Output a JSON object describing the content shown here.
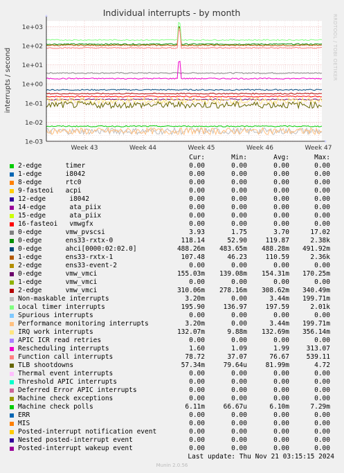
{
  "title": "Individual interrupts - by month",
  "watermark": "RRDTOOL / TOBI OETIKER",
  "footer": {
    "last_update": "Last update: Thu Nov 21 03:15:15 2024",
    "munin": "Munin 2.0.56"
  },
  "legend_headers": {
    "cur": "Cur:",
    "min": "Min:",
    "avg": "Avg:",
    "max": "Max:"
  },
  "chart_data": {
    "type": "line",
    "title": "Individual interrupts - by month",
    "ylabel": "interrupts / second",
    "yscale": "log",
    "ylim": [
      0.001,
      2000
    ],
    "yticks": [
      "1e-03",
      "1e-02",
      "1e-01",
      "1e+00",
      "1e+01",
      "1e+02",
      "1e+03"
    ],
    "xticks": [
      "Week 43",
      "Week 44",
      "Week 45",
      "Week 46",
      "Week 47"
    ],
    "grid": true,
    "series": [
      {
        "name": "2-edge      timer",
        "color": "#00cc00",
        "cur": "0.00",
        "min": "0.00",
        "avg": "0.00",
        "max": "0.00",
        "level": 0
      },
      {
        "name": "1-edge      i8042",
        "color": "#0066b3",
        "cur": "0.00",
        "min": "0.00",
        "avg": "0.00",
        "max": "0.00",
        "level": 0
      },
      {
        "name": "8-edge      rtc0",
        "color": "#ff8000",
        "cur": "0.00",
        "min": "0.00",
        "avg": "0.00",
        "max": "0.00",
        "level": 0
      },
      {
        "name": "9-fasteoi   acpi",
        "color": "#ffcc00",
        "cur": "0.00",
        "min": "0.00",
        "avg": "0.00",
        "max": "0.00",
        "level": 0
      },
      {
        "name": "12-edge      i8042",
        "color": "#330099",
        "cur": "0.00",
        "min": "0.00",
        "avg": "0.00",
        "max": "0.00",
        "level": 0
      },
      {
        "name": "14-edge      ata_piix",
        "color": "#990099",
        "cur": "0.00",
        "min": "0.00",
        "avg": "0.00",
        "max": "0.00",
        "level": 0
      },
      {
        "name": "15-edge      ata_piix",
        "color": "#ccff00",
        "cur": "0.00",
        "min": "0.00",
        "avg": "0.00",
        "max": "0.00",
        "level": 0
      },
      {
        "name": "16-fasteoi   vmwgfx",
        "color": "#ff0000",
        "cur": "0.00",
        "min": "0.00",
        "avg": "0.00",
        "max": "0.00",
        "level": 0.22
      },
      {
        "name": "0-edge      vmw_pvscsi",
        "color": "#808080",
        "cur": "3.93",
        "min": "1.75",
        "avg": "3.70",
        "max": "17.02",
        "level": 3.7
      },
      {
        "name": "0-edge      ens33-rxtx-0",
        "color": "#008f00",
        "cur": "118.14",
        "min": "52.90",
        "avg": "119.87",
        "max": "2.38k",
        "level": 120
      },
      {
        "name": "0-edge      ahci[0000:02:02.0]",
        "color": "#00487d",
        "cur": "488.26m",
        "min": "483.65m",
        "avg": "488.28m",
        "max": "491.92m",
        "level": 0.49
      },
      {
        "name": "1-edge      ens33-rxtx-1",
        "color": "#b35a00",
        "cur": "107.48",
        "min": "46.23",
        "avg": "110.59",
        "max": "2.36k",
        "level": 105
      },
      {
        "name": "2-edge      ens33-event-2",
        "color": "#b38f00",
        "cur": "0.00",
        "min": "0.00",
        "avg": "0.00",
        "max": "0.00",
        "level": 0
      },
      {
        "name": "0-edge      vmw_vmci",
        "color": "#6b006b",
        "cur": "155.03m",
        "min": "139.08m",
        "avg": "154.31m",
        "max": "170.25m",
        "level": 0.154
      },
      {
        "name": "1-edge      vmw_vmci",
        "color": "#8fb300",
        "cur": "0.00",
        "min": "0.00",
        "avg": "0.00",
        "max": "0.00",
        "level": 0
      },
      {
        "name": "2-edge      vmw_vmci",
        "color": "#b30000",
        "cur": "310.06m",
        "min": "278.16m",
        "avg": "308.62m",
        "max": "340.49m",
        "level": 0.31
      },
      {
        "name": "Non-maskable interrupts",
        "color": "#bebebe",
        "cur": "3.20m",
        "min": "0.00",
        "avg": "3.44m",
        "max": "199.71m",
        "level": 0.0034
      },
      {
        "name": "Local timer interrupts",
        "color": "#80ff80",
        "cur": "195.90",
        "min": "136.97",
        "avg": "197.59",
        "max": "2.01k",
        "level": 198
      },
      {
        "name": "Spurious interrupts",
        "color": "#80c9ff",
        "cur": "0.00",
        "min": "0.00",
        "avg": "0.00",
        "max": "0.00",
        "level": 0
      },
      {
        "name": "Performance monitoring interrupts",
        "color": "#ffc080",
        "cur": "3.20m",
        "min": "0.00",
        "avg": "3.44m",
        "max": "199.71m",
        "level": 0.0034
      },
      {
        "name": "IRQ work interrupts",
        "color": "#ffe680",
        "cur": "132.07m",
        "min": "9.88m",
        "avg": "132.69m",
        "max": "356.14m",
        "level": 0.13
      },
      {
        "name": "APIC ICR read retries",
        "color": "#aa80ff",
        "cur": "0.00",
        "min": "0.00",
        "avg": "0.00",
        "max": "0.00",
        "level": 0
      },
      {
        "name": "Rescheduling interrupts",
        "color": "#ee00cc",
        "cur": "1.60",
        "min": "1.09",
        "avg": "1.99",
        "max": "313.07",
        "level": 1.9
      },
      {
        "name": "Function call interrupts",
        "color": "#ff8080",
        "cur": "78.72",
        "min": "37.07",
        "avg": "76.67",
        "max": "539.11",
        "level": 76
      },
      {
        "name": "TLB shootdowns",
        "color": "#666600",
        "cur": "57.34m",
        "min": "79.64u",
        "avg": "81.99m",
        "max": "4.72",
        "level": 0.08
      },
      {
        "name": "Thermal event interrupts",
        "color": "#ffbfff",
        "cur": "0.00",
        "min": "0.00",
        "avg": "0.00",
        "max": "0.00",
        "level": 0
      },
      {
        "name": "Threshold APIC interrupts",
        "color": "#00ffcc",
        "cur": "0.00",
        "min": "0.00",
        "avg": "0.00",
        "max": "0.00",
        "level": 0
      },
      {
        "name": "Deferred Error APIC interrupts",
        "color": "#cc6699",
        "cur": "0.00",
        "min": "0.00",
        "avg": "0.00",
        "max": "0.00",
        "level": 0
      },
      {
        "name": "Machine check exceptions",
        "color": "#999900",
        "cur": "0.00",
        "min": "0.00",
        "avg": "0.00",
        "max": "0.00",
        "level": 0
      },
      {
        "name": "Machine check polls",
        "color": "#00cc00",
        "cur": "6.11m",
        "min": "66.67u",
        "avg": "6.10m",
        "max": "7.29m",
        "level": 0.0061
      },
      {
        "name": "ERR",
        "color": "#0066b3",
        "cur": "0.00",
        "min": "0.00",
        "avg": "0.00",
        "max": "0.00",
        "level": 0
      },
      {
        "name": "MIS",
        "color": "#ff8000",
        "cur": "0.00",
        "min": "0.00",
        "avg": "0.00",
        "max": "0.00",
        "level": 0
      },
      {
        "name": "Posted-interrupt notification event",
        "color": "#ffcc00",
        "cur": "0.00",
        "min": "0.00",
        "avg": "0.00",
        "max": "0.00",
        "level": 0
      },
      {
        "name": "Nested posted-interrupt event",
        "color": "#330099",
        "cur": "0.00",
        "min": "0.00",
        "avg": "0.00",
        "max": "0.00",
        "level": 0
      },
      {
        "name": "Posted-interrupt wakeup event",
        "color": "#990099",
        "cur": "0.00",
        "min": "0.00",
        "avg": "0.00",
        "max": "0.00",
        "level": 0
      }
    ]
  }
}
